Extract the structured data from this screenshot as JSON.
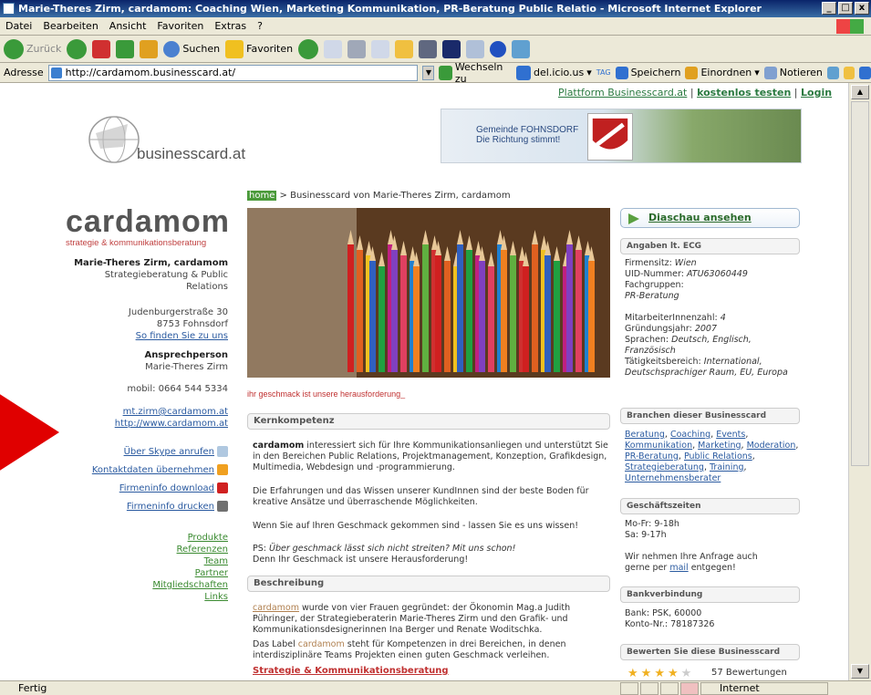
{
  "window": {
    "title": "Marie-Theres Zirm, cardamom: Coaching Wien, Marketing Kommunikation, PR-Beratung Public Relatio - Microsoft Internet Explorer",
    "buttons": [
      "_",
      "□",
      "x"
    ]
  },
  "menubar": [
    "Datei",
    "Bearbeiten",
    "Ansicht",
    "Favoriten",
    "Extras",
    "?"
  ],
  "toolbar": {
    "back": "Zurück",
    "search": "Suchen",
    "favorites": "Favoriten"
  },
  "addressbar": {
    "label": "Adresse",
    "url": "http://cardamom.businesscard.at/",
    "go": "Wechseln zu",
    "delicious": "del.icio.us",
    "tag": "TAG",
    "save": "Speichern",
    "sort": "Einordnen",
    "notes": "Notieren"
  },
  "page": {
    "topnav": {
      "prefix": "Plattform Businesscard.at",
      "sep": "|",
      "trial": "kostenlos testen",
      "sep2": "|",
      "login": "Login"
    },
    "site_logo": "businesscard.at",
    "banner": {
      "line1": "Gemeinde FOHNSDORF",
      "line2": "Die Richtung stimmt!"
    },
    "breadcrumb": {
      "home": "home",
      "rest": " > Businesscard von Marie-Theres Zirm, cardamom"
    },
    "left": {
      "logo": "cardamom",
      "logo_sub": "strategie & kommunikationsberatung",
      "name": "Marie-Theres Zirm, cardamom",
      "desc1": "Strategieberatung & Public",
      "desc2": "Relations",
      "street": "Judenburgerstraße 30",
      "city": "8753 Fohnsdorf",
      "find": "So finden Sie zu uns",
      "contact_head": "Ansprechperson",
      "contact_name": "Marie-Theres Zirm",
      "mobile": "mobil: 0664 544 5334",
      "email": "mt.zirm@cardamom.at",
      "web": "http://www.cardamom.at",
      "skype": "Über Skype anrufen",
      "vcard": "Kontaktdaten übernehmen",
      "download": "Firmeninfo download",
      "print": "Firmeninfo drucken",
      "nav": [
        "Produkte",
        "Referenzen",
        "Team",
        "Partner",
        "Mitgliedschaften",
        "Links"
      ]
    },
    "center": {
      "tagline": "ihr geschmack ist unsere herausforderung_",
      "kern_head": "Kernkompetenz",
      "kern1_brand": "cardamom",
      "kern1_rest": " interessiert sich für Ihre Kommunikationsanliegen und unterstützt Sie in den Bereichen Public Relations, Projektmanagement, Konzeption, Grafikdesign, Multimedia, Webdesign und -programmierung.",
      "kern2": "Die Erfahrungen und das Wissen unserer KundInnen sind der beste Boden für kreative Ansätze und überraschende Möglichkeiten.",
      "kern3": "Wenn Sie auf Ihren Geschmack gekommen sind - lassen Sie es uns wissen!",
      "kern4a": "PS: ",
      "kern4b": "Über geschmack lässt sich nicht streiten? Mit uns schon!",
      "kern4c": "Denn Ihr Geschmack ist unsere Herausforderung!",
      "besch_head": "Beschreibung",
      "besch1_brand": "cardamom",
      "besch1_rest": " wurde von vier Frauen gegründet: der Ökonomin Mag.a Judith Pühringer, der Strategieberaterin Marie-Theres Zirm und den Grafik- und Kommunikationsdesignerinnen Ina Berger und Renate Woditschka.",
      "besch2_a": "Das Label ",
      "besch2_brand": "cardamom",
      "besch2_b": " steht für Kompetenzen in drei Bereichen, in denen interdisziplinäre Teams Projekten einen guten Geschmack verleihen.",
      "strat": "Strategie & Kommunikationsberatung"
    },
    "right": {
      "diaschau": "Diaschau ansehen",
      "ecg_head": "Angaben lt. ECG",
      "sitz_label": "Firmensitz: ",
      "sitz": "Wien",
      "uid_label": "UID-Nummer: ",
      "uid": "ATU63060449",
      "fach_label": "Fachgruppen:",
      "fach": "PR-Beratung",
      "mitarb_label": "MitarbeiterInnenzahl: ",
      "mitarb": "4",
      "jahr_label": "Gründungsjahr: ",
      "jahr": "2007",
      "sprachen_label": "Sprachen: ",
      "sprachen": "Deutsch, Englisch, Französisch",
      "taetig_label": "Tätigkeitsbereich: ",
      "taetig": "International, Deutschsprachiger Raum, EU, Europa",
      "branchen_head": "Branchen dieser Businesscard",
      "branchen": [
        "Beratung",
        "Coaching",
        "Events",
        "Kommunikation",
        "Marketing",
        "Moderation",
        "PR-Beratung",
        "Public Relations",
        "Strategieberatung",
        "Training",
        "Unternehmensberater"
      ],
      "zeiten_head": "Geschäftszeiten",
      "zeiten1": "Mo-Fr: 9-18h",
      "zeiten2": "Sa: 9-17h",
      "anfrage1": "Wir nehmen Ihre Anfrage auch",
      "anfrage2a": "gerne per ",
      "anfrage2_link": "mail",
      "anfrage2b": " entgegen!",
      "bank_head": "Bankverbindung",
      "bank1": "Bank: PSK, 60000",
      "bank2": "Konto-Nr.: 78187326",
      "bewerten_head": "Bewerten Sie diese Businesscard",
      "rating": 4,
      "rating_max": 5,
      "bewertungen": "57 Bewertungen"
    }
  },
  "statusbar": {
    "status": "Fertig",
    "zone": "Internet"
  }
}
